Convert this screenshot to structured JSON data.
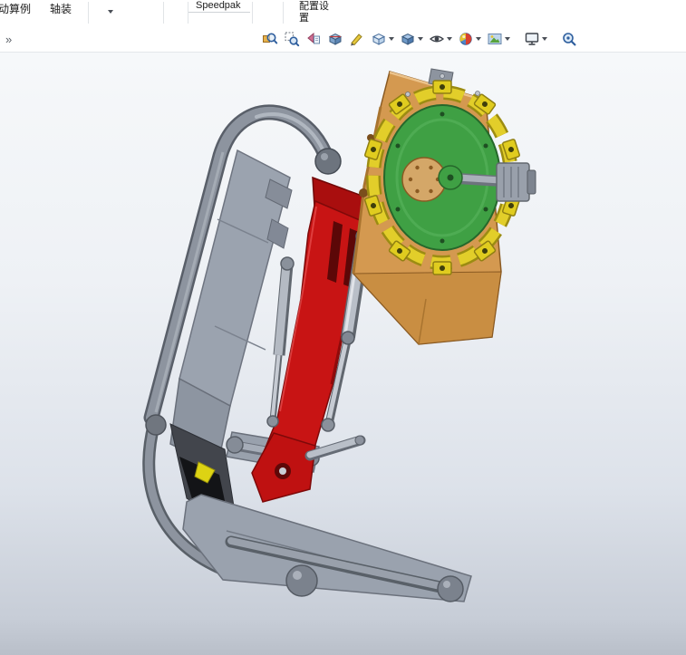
{
  "ribbon": {
    "tabs": [
      {
        "label": "动算例"
      },
      {
        "label": "轴装"
      },
      {
        "label": "Speedpak"
      },
      {
        "label": "配置设置"
      }
    ]
  },
  "view_toolbar": {
    "overflow_chevron": "»",
    "buttons": [
      {
        "name": "zoom-to-fit",
        "dropdown": false
      },
      {
        "name": "zoom-to-area",
        "dropdown": false
      },
      {
        "name": "previous-view",
        "dropdown": false
      },
      {
        "name": "section-view",
        "dropdown": false
      },
      {
        "name": "dynamic-annotation-views",
        "dropdown": false
      },
      {
        "name": "view-orientation",
        "dropdown": true
      },
      {
        "name": "display-style",
        "dropdown": true
      },
      {
        "name": "hide-show-items",
        "dropdown": true
      },
      {
        "name": "edit-appearance",
        "dropdown": true
      },
      {
        "name": "apply-scene",
        "dropdown": true
      },
      {
        "name": "view-settings",
        "dropdown": true
      },
      {
        "name": "magnified-selection",
        "dropdown": false
      }
    ]
  },
  "viewport": {
    "background_top": "#f6f8fa",
    "background_bottom": "#b9bfc9",
    "model_parts": [
      {
        "name": "boom-tube-frame",
        "color": "#8d949f"
      },
      {
        "name": "boom-panel",
        "color": "#9ba3af"
      },
      {
        "name": "base-frame",
        "color": "#9aa2ae"
      },
      {
        "name": "link-plates",
        "color": "#99a1ad"
      },
      {
        "name": "arm-red",
        "color": "#c81414"
      },
      {
        "name": "hydraulic-cylinders",
        "color": "#b9bfc8"
      },
      {
        "name": "mount-bracket-orange",
        "color": "#d49950"
      },
      {
        "name": "cutter-disc-green",
        "color": "#3fa044"
      },
      {
        "name": "cutter-teeth-yellow",
        "color": "#e0cc1f"
      },
      {
        "name": "drive-motor",
        "color": "#99a0ab"
      }
    ]
  }
}
